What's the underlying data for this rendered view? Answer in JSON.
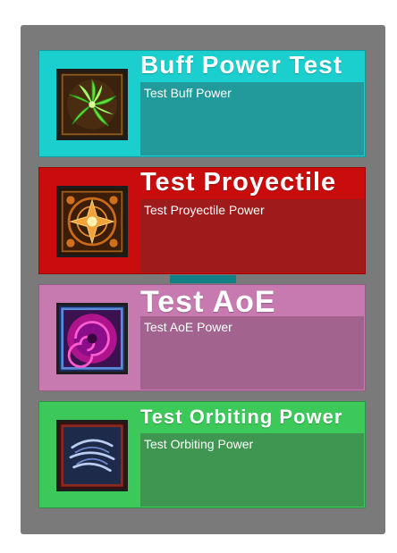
{
  "cards": [
    {
      "title": "Buff Power Test",
      "description": "Test Buff Power",
      "icon": "green-leaf-icon",
      "colors": {
        "background": "#1ccfcf",
        "desc_box": "#229a9c"
      }
    },
    {
      "title": "Test Proyectile",
      "description": "Test Proyectile Power",
      "icon": "orange-star-burst-icon",
      "colors": {
        "background": "#c90c0c",
        "desc_box": "#9f1b1b"
      }
    },
    {
      "title": "Test AoE",
      "description": "Test AoE Power",
      "icon": "purple-vortex-icon",
      "colors": {
        "background": "#c77ab0",
        "desc_box": "#a2638e"
      }
    },
    {
      "title": "Test Orbiting Power",
      "description": "Test Orbiting Power",
      "icon": "blue-whirlwind-icon",
      "colors": {
        "background": "#3cc95a",
        "desc_box": "#3e9650"
      }
    }
  ]
}
